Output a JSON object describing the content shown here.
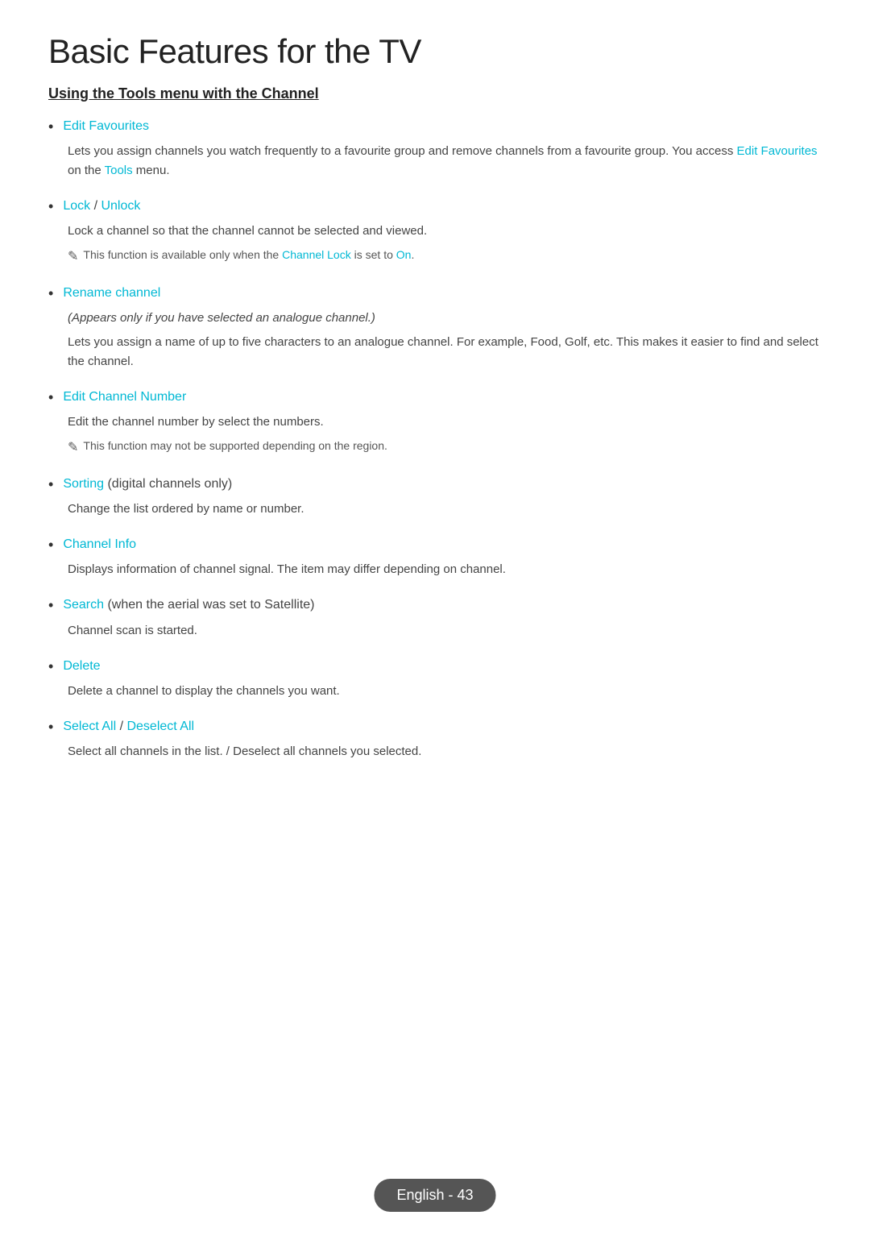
{
  "page": {
    "title": "Basic Features for the TV",
    "section_heading": "Using the Tools menu with the Channel",
    "footer_label": "English - 43"
  },
  "items": [
    {
      "id": "edit-favourites",
      "label_link": "Edit Favourites",
      "label_rest": "",
      "body": [
        {
          "type": "text",
          "content": "Lets you assign channels you watch frequently to a favourite group and remove channels from a favourite group. You access "
        },
        {
          "type": "text",
          "content": "Edit Favourites",
          "link": true
        },
        {
          "type": "text",
          "content": " on the "
        },
        {
          "type": "text",
          "content": "Tools",
          "link": true
        },
        {
          "type": "text",
          "content": " menu."
        }
      ]
    },
    {
      "id": "lock-unlock",
      "label_link": "Lock",
      "label_separator": " / ",
      "label_link2": "Unlock",
      "body_plain": "Lock a channel so that the channel cannot be selected and viewed.",
      "note": "This function is available only when the ",
      "note_link": "Channel Lock",
      "note_mid": " is set to ",
      "note_link2": "On",
      "note_end": "."
    },
    {
      "id": "rename-channel",
      "label_link": "Rename channel",
      "body_italic": "(Appears only if you have selected an analogue channel.)",
      "body_plain": "Lets you assign a name of up to five characters to an analogue channel. For example, Food, Golf, etc. This makes it easier to find and select the channel."
    },
    {
      "id": "edit-channel-number",
      "label_link": "Edit Channel Number",
      "body_plain": "Edit the channel number by select the numbers.",
      "note": "This function may not be supported depending on the region."
    },
    {
      "id": "sorting",
      "label_link": "Sorting",
      "label_rest": " (digital channels only)",
      "body_plain": "Change the list ordered by name or number."
    },
    {
      "id": "channel-info",
      "label_link": "Channel Info",
      "body_plain": "Displays information of channel signal. The item may differ depending on channel."
    },
    {
      "id": "search",
      "label_link": "Search",
      "label_rest": " (when the aerial was set to Satellite)",
      "body_plain": "Channel scan is started."
    },
    {
      "id": "delete",
      "label_link": "Delete",
      "body_plain": "Delete a channel to display the channels you want."
    },
    {
      "id": "select-all",
      "label_link": "Select All",
      "label_separator": " / ",
      "label_link2": "Deselect All",
      "body_plain": "Select all channels in the list. / Deselect all channels you selected."
    }
  ],
  "colors": {
    "link": "#00b8d4",
    "text": "#444444",
    "heading": "#222222"
  }
}
